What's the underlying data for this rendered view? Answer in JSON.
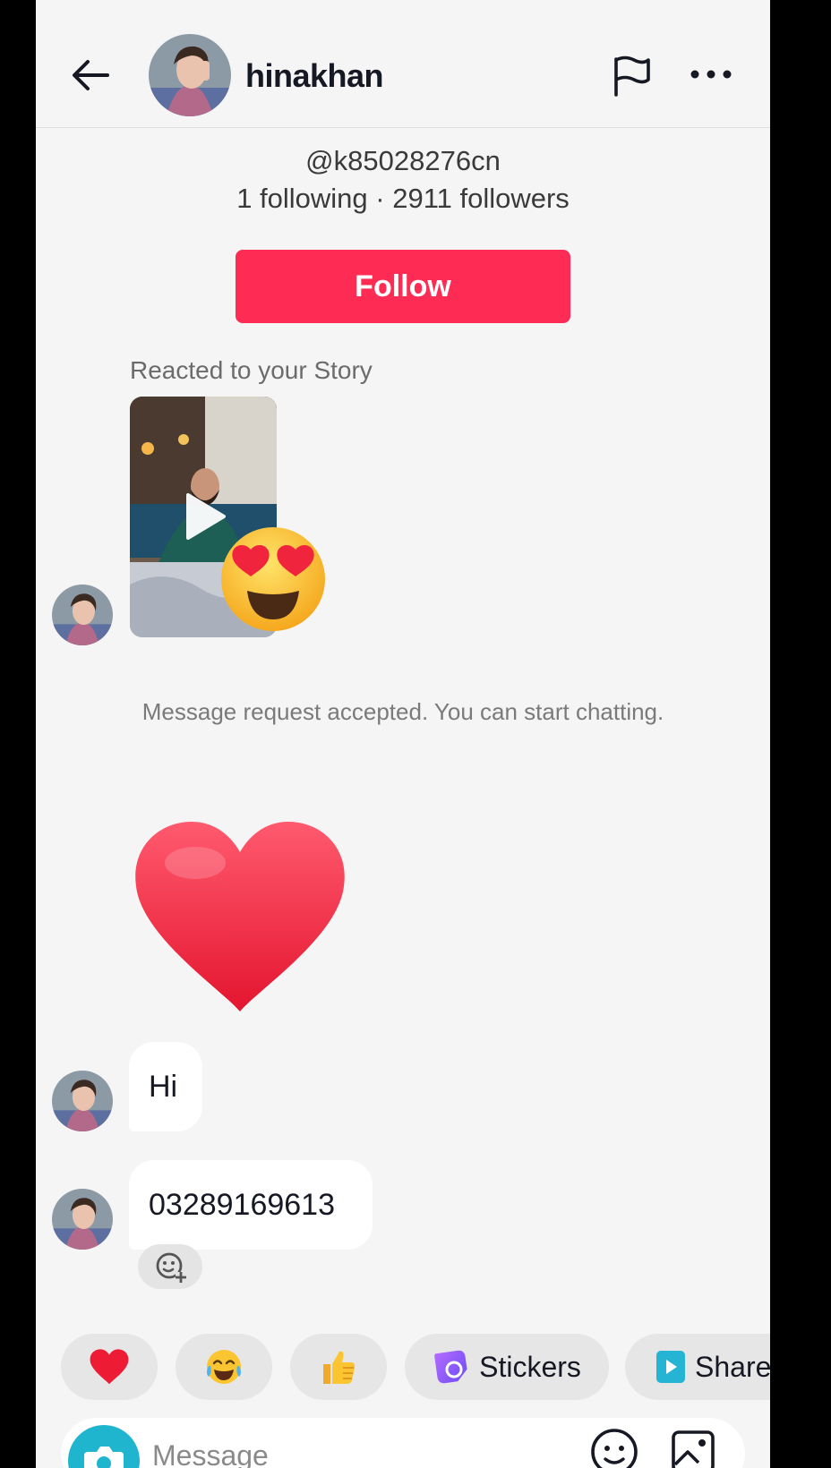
{
  "header": {
    "username": "hinakhan",
    "icons": {
      "back": "arrow-left-icon",
      "report": "flag-icon",
      "more": "more-horizontal-icon"
    }
  },
  "profile": {
    "handle": "@k85028276cn",
    "stats": "1 following · 2911 followers",
    "follow_label": "Follow"
  },
  "conversation": {
    "story_caption": "Reacted to your Story",
    "story_reaction": "heart-eyes-emoji",
    "system_message": "Message request accepted. You can start chatting.",
    "heart_sticker": "red-heart-emoji",
    "messages": [
      {
        "text": "Hi"
      },
      {
        "text": "03289169613"
      }
    ]
  },
  "quick_replies": {
    "chips": [
      {
        "icon": "heart-emoji"
      },
      {
        "icon": "tears-of-joy-emoji"
      },
      {
        "icon": "thumbs-up-emoji"
      },
      {
        "icon": "sticker-icon",
        "label": "Stickers"
      },
      {
        "icon": "share-video-icon",
        "label": "Share"
      }
    ]
  },
  "composer": {
    "placeholder": "Message"
  },
  "colors": {
    "accent": "#fe2c55",
    "background": "#f5f5f5",
    "camera": "#20b5ce",
    "bubble": "#ffffff"
  }
}
